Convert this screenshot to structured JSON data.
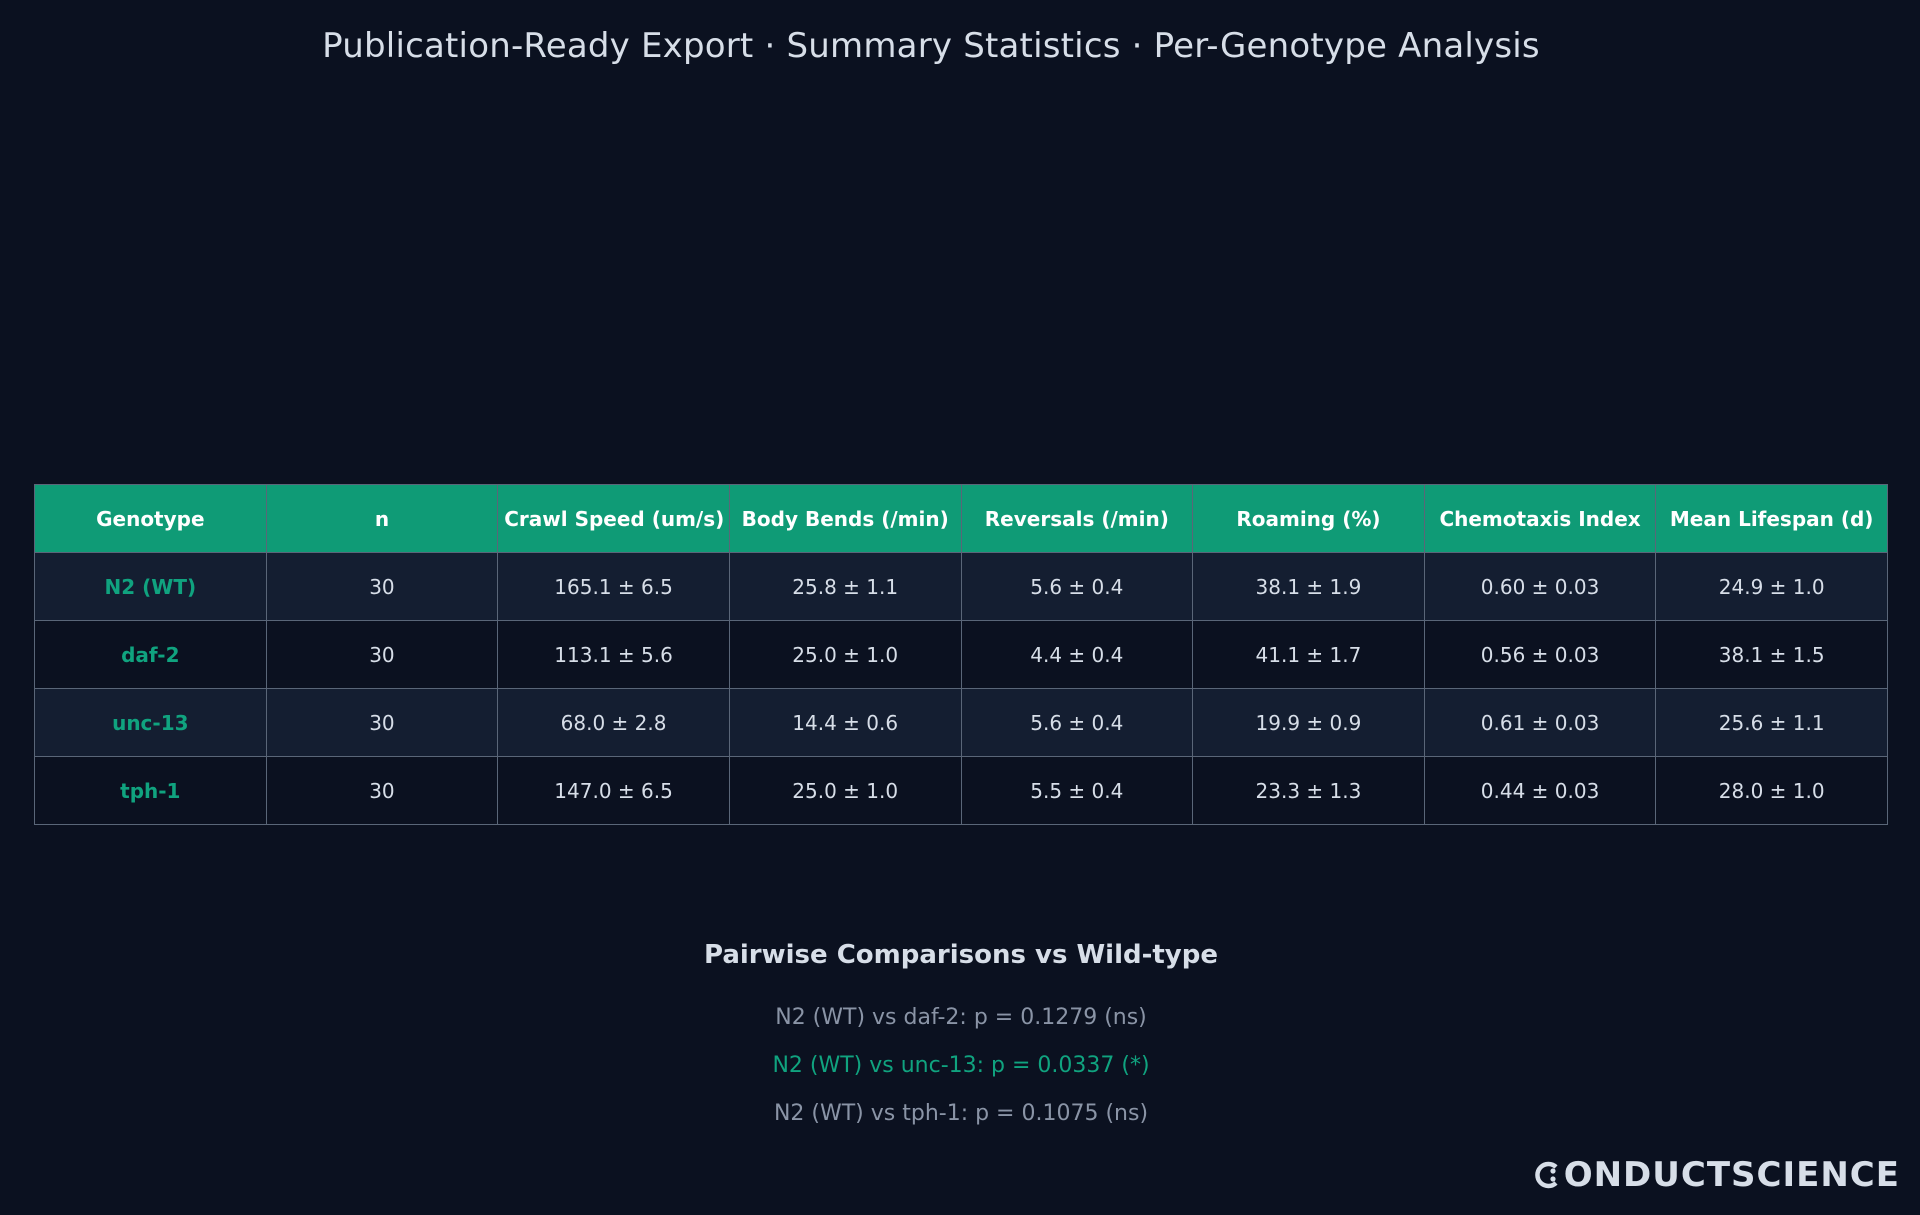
{
  "header": {
    "title": "Publication-Ready Export · Summary Statistics · Per-Genotype Analysis"
  },
  "table": {
    "columns": [
      "Genotype",
      "n",
      "Crawl Speed (um/s)",
      "Body Bends (/min)",
      "Reversals (/min)",
      "Roaming (%)",
      "Chemotaxis Index",
      "Mean Lifespan (d)"
    ],
    "rows": [
      [
        "N2 (WT)",
        "30",
        "165.1 ± 6.5",
        "25.8 ± 1.1",
        "5.6 ± 0.4",
        "38.1 ± 1.9",
        "0.60 ± 0.03",
        "24.9 ± 1.0"
      ],
      [
        "daf-2",
        "30",
        "113.1 ± 5.6",
        "25.0 ± 1.0",
        "4.4 ± 0.4",
        "41.1 ± 1.7",
        "0.56 ± 0.03",
        "38.1 ± 1.5"
      ],
      [
        "unc-13",
        "30",
        "68.0 ± 2.8",
        "14.4 ± 0.6",
        "5.6 ± 0.4",
        "19.9 ± 0.9",
        "0.61 ± 0.03",
        "25.6 ± 1.1"
      ],
      [
        "tph-1",
        "30",
        "147.0 ± 6.5",
        "25.0 ± 1.0",
        "5.5 ± 0.4",
        "23.3 ± 1.3",
        "0.44 ± 0.03",
        "28.0 ± 1.0"
      ]
    ]
  },
  "comparisons": {
    "title": "Pairwise Comparisons vs Wild-type",
    "items": [
      {
        "text": "N2 (WT) vs daf-2: p = 0.1279 (ns)",
        "significant": false
      },
      {
        "text": "N2 (WT) vs unc-13: p = 0.0337 (*)",
        "significant": true
      },
      {
        "text": "N2 (WT) vs tph-1: p = 0.1075 (ns)",
        "significant": false
      }
    ]
  },
  "brand": {
    "name": "ONDUCTSCIENCE",
    "icon": "conductscience-c-logo-icon"
  },
  "colors": {
    "background": "#0b1120",
    "header_accent": "#0f9b76",
    "genotype_text": "#10a37f",
    "significant_text": "#10a37f",
    "muted_text": "#8a94a6"
  }
}
